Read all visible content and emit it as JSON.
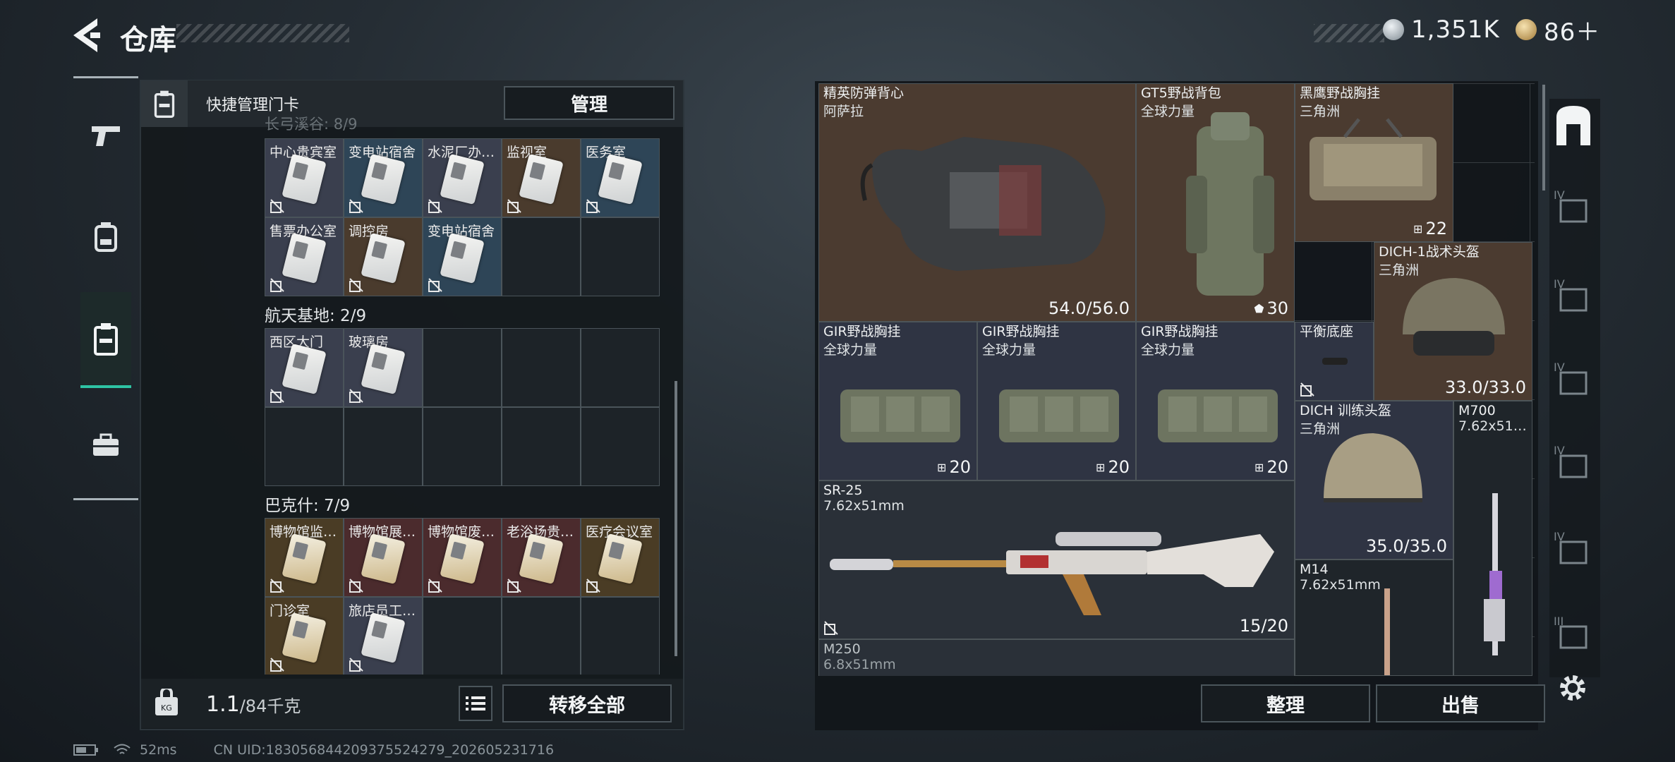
{
  "header": {
    "title": "仓库",
    "currency1": "1,351K",
    "currency2": "86＋",
    "currency1_color": "#cfd6dc",
    "currency2_color": "#c7a261"
  },
  "left_panel": {
    "key_bar_label": "快捷管理门卡",
    "manage_button": "管理",
    "section_top_partial": "长弓溪谷: 8/9",
    "grid1": [
      {
        "label": "中心贵宾室",
        "color": "slate"
      },
      {
        "label": "变电站宿舍",
        "color": "blue"
      },
      {
        "label": "水泥厂办…",
        "color": "slate"
      },
      {
        "label": "监视室",
        "color": "brown"
      },
      {
        "label": "医务室",
        "color": "blue"
      },
      {
        "label": "售票办公室",
        "color": "slate"
      },
      {
        "label": "调控房",
        "color": "brown"
      },
      {
        "label": "变电站宿舍",
        "color": "blue"
      }
    ],
    "section2": "航天基地: 2/9",
    "grid2": [
      {
        "label": "西区大门",
        "color": "slate"
      },
      {
        "label": "玻璃房",
        "color": "slate"
      }
    ],
    "section3": "巴克什: 7/9",
    "grid3": [
      {
        "label": "博物馆监…",
        "color": "gold"
      },
      {
        "label": "博物馆展…",
        "color": "red"
      },
      {
        "label": "博物馆废…",
        "color": "red"
      },
      {
        "label": "老浴场贵…",
        "color": "red"
      },
      {
        "label": "医疗会议室",
        "color": "gold"
      },
      {
        "label": "门诊室",
        "color": "gold"
      },
      {
        "label": "旅店员工…",
        "color": "slate"
      }
    ],
    "weight_value": "1.1",
    "weight_unit": "/84千克",
    "transfer_all": "转移全部"
  },
  "right_panel": {
    "items": [
      {
        "name": "精英防弹背心",
        "sub": "阿萨拉",
        "value": "54.0/56.0"
      },
      {
        "name": "GT5野战背包",
        "sub": "全球力量",
        "value": "30"
      },
      {
        "name": "黑鹰野战胸挂",
        "sub": "三角洲",
        "value": "22"
      },
      {
        "name": "DICH-1战术头盔",
        "sub": "三角洲",
        "value": "33.0/33.0"
      },
      {
        "name": "GIR野战胸挂",
        "sub": "全球力量",
        "value": "20"
      },
      {
        "name": "GIR野战胸挂",
        "sub": "全球力量",
        "value": "20"
      },
      {
        "name": "GIR野战胸挂",
        "sub": "全球力量",
        "value": "20"
      },
      {
        "name": "平衡底座",
        "sub": "",
        "value": ""
      },
      {
        "name": "DICH 训练头盔",
        "sub": "三角洲",
        "value": "35.0/35.0"
      },
      {
        "name": "M700",
        "sub": "7.62x51…",
        "value": ""
      },
      {
        "name": "SR-25",
        "sub": "7.62x51mm",
        "value": "15/20"
      },
      {
        "name": "M14",
        "sub": "7.62x51mm",
        "value": ""
      },
      {
        "name": "M250",
        "sub": "6.8x51mm",
        "value": ""
      }
    ],
    "sort_button": "整理",
    "sell_button": "出售"
  },
  "status_bar": {
    "ping": "52ms",
    "uid": "CN UID:18305684420937552427​9_202605231716"
  }
}
